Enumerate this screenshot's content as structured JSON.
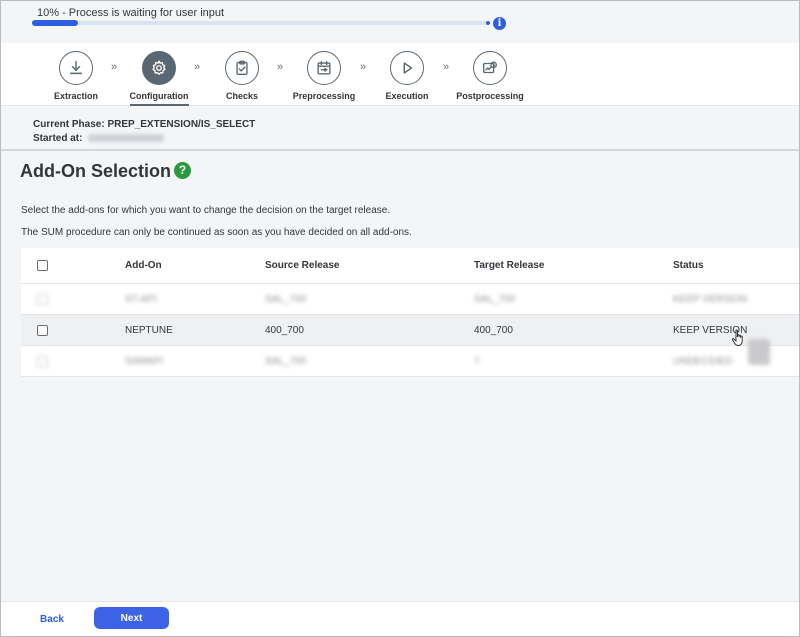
{
  "progress": {
    "text": "10% - Process is waiting for user input",
    "percent": 10,
    "accent": "#2d5ede",
    "info_icon": "i"
  },
  "steps": [
    {
      "label": "Extraction",
      "icon": "download-icon",
      "active": false
    },
    {
      "label": "Configuration",
      "icon": "gear-icon",
      "active": true
    },
    {
      "label": "Checks",
      "icon": "clipboard-check-icon",
      "active": false
    },
    {
      "label": "Preprocessing",
      "icon": "calendar-icon",
      "active": false
    },
    {
      "label": "Execution",
      "icon": "play-icon",
      "active": false
    },
    {
      "label": "Postprocessing",
      "icon": "report-icon",
      "active": false
    }
  ],
  "step_separator": "»",
  "phase": {
    "current_label": "Current Phase: PREP_EXTENSION/IS_SELECT",
    "started_label": "Started at:"
  },
  "page": {
    "title": "Add-On Selection",
    "help_icon": "?",
    "help_color": "#2b9a3f",
    "instruction_1": "Select the add-ons for which you want to change the decision on the target release.",
    "instruction_2": "The SUM procedure can only be continued as soon as you have decided on all add-ons."
  },
  "table": {
    "columns": [
      "Add-On",
      "Source Release",
      "Target Release",
      "Status"
    ],
    "rows": [
      {
        "addon": "ST-API",
        "source": "SAL_700",
        "target": "SAL_700",
        "status": "KEEP VERSION",
        "blurred": true
      },
      {
        "addon": "NEPTUNE",
        "source": "400_700",
        "target": "400_700",
        "status": "KEEP VERSION",
        "blurred": false
      },
      {
        "addon": "SAMAPI",
        "source": "SAL_700",
        "target": "?",
        "status": "UNDECIDED",
        "blurred": true
      }
    ]
  },
  "footer": {
    "back_label": "Back",
    "next_label": "Next",
    "primary_color": "#3c63e6"
  }
}
